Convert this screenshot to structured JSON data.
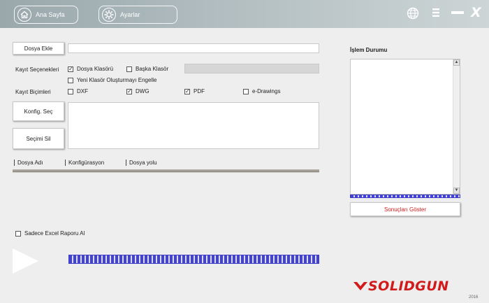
{
  "header": {
    "home_label": "Ana Sayfa",
    "settings_label": "Ayarlar",
    "icons": [
      "home-icon",
      "gear-icon",
      "globe-icon",
      "menu-icon",
      "minimize-icon",
      "close-icon"
    ]
  },
  "form": {
    "add_file_label": "Dosya Ekle",
    "add_file_value": "",
    "save_options_label": "Kayıt Seçenekleri",
    "opt_file_folder": "Dosya Klasörü",
    "opt_other_folder": "Başka Klasör",
    "other_folder_path": "",
    "opt_no_new_folder": "Yeni Klasör Oluşturmayı Engelle",
    "save_formats_label": "Kayıt Biçimleri",
    "fmt_dxf": "DXF",
    "fmt_dwg": "DWG",
    "fmt_pdf": "PDF",
    "fmt_edrawings": "e-Drawings",
    "config_select": "Konfig. Seç",
    "delete_selection": "Seçimi Sil",
    "columns": [
      "Dosya Adı",
      "Konfigürasyon",
      "Dosya yolu"
    ],
    "excel_only": "Sadece Excel Raporu Al"
  },
  "status": {
    "title": "İşlem Durumu",
    "show_results": "Sonuçları Göster"
  },
  "brand": {
    "name": "SOLIDGUN",
    "year": "2016",
    "color": "#d21a1a"
  },
  "state": {
    "file_folder_checked": true,
    "other_folder_checked": false,
    "no_new_folder_checked": false,
    "dxf_checked": false,
    "dwg_checked": true,
    "pdf_checked": true,
    "edrawings_checked": false,
    "excel_only_checked": false
  }
}
